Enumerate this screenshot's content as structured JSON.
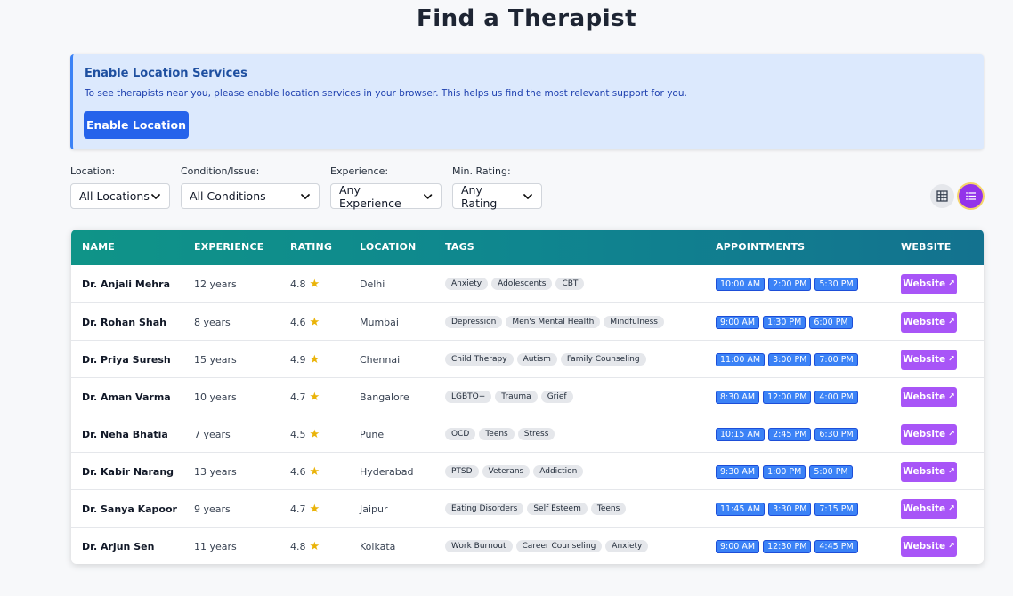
{
  "page": {
    "title": "Find a Therapist"
  },
  "alert": {
    "title": "Enable Location Services",
    "text": "To see therapists near you, please enable location services in your browser. This helps us find the most relevant support for you.",
    "button": "Enable Location"
  },
  "filters": [
    {
      "label": "Location:",
      "value": "All Locations"
    },
    {
      "label": "Condition/Issue:",
      "value": "All Conditions"
    },
    {
      "label": "Experience:",
      "value": "Any Experience"
    },
    {
      "label": "Min. Rating:",
      "value": "Any Rating"
    }
  ],
  "view_toggle": {
    "grid_icon": "grid-icon",
    "list_icon": "list-icon",
    "active": "list"
  },
  "table": {
    "headers": [
      "NAME",
      "EXPERIENCE",
      "RATING",
      "LOCATION",
      "TAGS",
      "APPOINTMENTS",
      "WEBSITE"
    ],
    "rows": [
      {
        "name": "Dr. Anjali Mehra",
        "experience": "12 years",
        "rating": "4.8",
        "location": "Delhi",
        "tags": [
          "Anxiety",
          "Adolescents",
          "CBT"
        ],
        "slots": [
          "10:00 AM",
          "2:00 PM",
          "5:30 PM"
        ],
        "website": "Website"
      },
      {
        "name": "Dr. Rohan Shah",
        "experience": "8 years",
        "rating": "4.6",
        "location": "Mumbai",
        "tags": [
          "Depression",
          "Men's Mental Health",
          "Mindfulness"
        ],
        "slots": [
          "9:00 AM",
          "1:30 PM",
          "6:00 PM"
        ],
        "website": "Website"
      },
      {
        "name": "Dr. Priya Suresh",
        "experience": "15 years",
        "rating": "4.9",
        "location": "Chennai",
        "tags": [
          "Child Therapy",
          "Autism",
          "Family Counseling"
        ],
        "slots": [
          "11:00 AM",
          "3:00 PM",
          "7:00 PM"
        ],
        "website": "Website"
      },
      {
        "name": "Dr. Aman Varma",
        "experience": "10 years",
        "rating": "4.7",
        "location": "Bangalore",
        "tags": [
          "LGBTQ+",
          "Trauma",
          "Grief"
        ],
        "slots": [
          "8:30 AM",
          "12:00 PM",
          "4:00 PM"
        ],
        "website": "Website"
      },
      {
        "name": "Dr. Neha Bhatia",
        "experience": "7 years",
        "rating": "4.5",
        "location": "Pune",
        "tags": [
          "OCD",
          "Teens",
          "Stress"
        ],
        "slots": [
          "10:15 AM",
          "2:45 PM",
          "6:30 PM"
        ],
        "website": "Website"
      },
      {
        "name": "Dr. Kabir Narang",
        "experience": "13 years",
        "rating": "4.6",
        "location": "Hyderabad",
        "tags": [
          "PTSD",
          "Veterans",
          "Addiction"
        ],
        "slots": [
          "9:30 AM",
          "1:00 PM",
          "5:00 PM"
        ],
        "website": "Website"
      },
      {
        "name": "Dr. Sanya Kapoor",
        "experience": "9 years",
        "rating": "4.7",
        "location": "Jaipur",
        "tags": [
          "Eating Disorders",
          "Self Esteem",
          "Teens"
        ],
        "slots": [
          "11:45 AM",
          "3:30 PM",
          "7:15 PM"
        ],
        "website": "Website"
      },
      {
        "name": "Dr. Arjun Sen",
        "experience": "11 years",
        "rating": "4.8",
        "location": "Kolkata",
        "tags": [
          "Work Burnout",
          "Career Counseling",
          "Anxiety"
        ],
        "slots": [
          "9:00 AM",
          "12:30 PM",
          "4:45 PM"
        ],
        "website": "Website"
      }
    ]
  },
  "colors": {
    "primary_button": "#2563eb",
    "website_button": "#a855f7",
    "slot_badge": "#3b82f6",
    "header_gradient_start": "#0f9488",
    "header_gradient_end": "#13728f",
    "active_view": "#9333ea"
  }
}
